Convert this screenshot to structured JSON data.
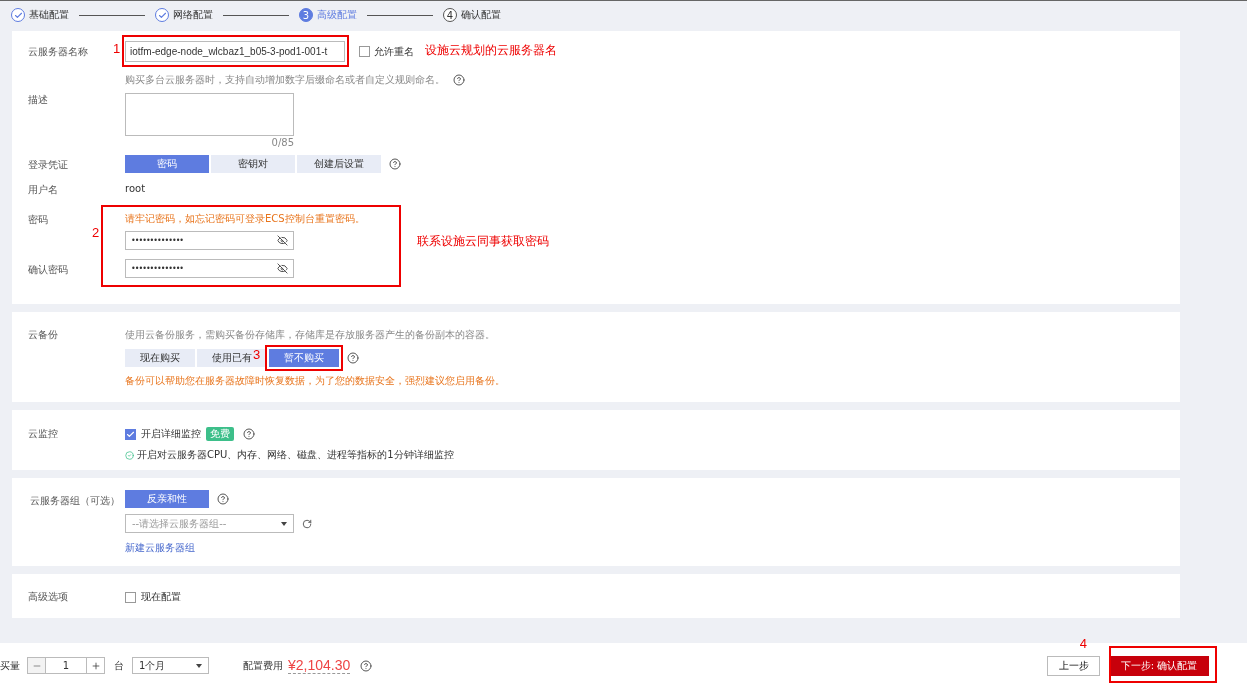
{
  "steps": [
    {
      "label": "基础配置",
      "done": true,
      "selected": false
    },
    {
      "label": "网络配置",
      "done": true,
      "selected": false
    },
    {
      "number": "3",
      "label": "高级配置",
      "done": false,
      "selected": true
    },
    {
      "number": "4",
      "label": "确认配置",
      "done": false,
      "selected": false
    }
  ],
  "server_name": {
    "label": "云服务器名称",
    "value": "iotfm-edge-node_wlcbaz1_b05-3-pod1-001-t",
    "allow_duplicate": {
      "label": "允许重名",
      "checked": false
    },
    "hint": "购买多台云服务器时，支持自动增加数字后缀命名或者自定义规则命名。"
  },
  "description": {
    "label": "描述",
    "counter": "0/85"
  },
  "login": {
    "label": "登录凭证",
    "options": [
      {
        "label": "密码",
        "selected": true
      },
      {
        "label": "密钥对",
        "selected": false
      },
      {
        "label": "创建后设置",
        "selected": false
      }
    ]
  },
  "username": {
    "label": "用户名",
    "value": "root"
  },
  "password": {
    "label": "密码",
    "warning": "请牢记密码，如忘记密码可登录ECS控制台重置密码。",
    "value": "••••••••••••••"
  },
  "confirm_password": {
    "label": "确认密码",
    "value": "••••••••••••••"
  },
  "backup": {
    "label": "云备份",
    "description": "使用云备份服务，需购买备份存储库，存储库是存放服务器产生的备份副本的容器。",
    "options": [
      {
        "label": "现在购买",
        "selected": false
      },
      {
        "label": "使用已有",
        "selected": false
      },
      {
        "label": "暂不购买",
        "selected": true
      }
    ],
    "warning": "备份可以帮助您在服务器故障时恢复数据，为了您的数据安全，强烈建议您启用备份。"
  },
  "monitoring": {
    "label": "云监控",
    "option": {
      "label": "开启详细监控",
      "checked": true
    },
    "badge": "免费",
    "note": "开启对云服务器CPU、内存、网络、磁盘、进程等指标的1分钟详细监控"
  },
  "server_group": {
    "label": "云服务器组（可选）",
    "policy_button": "反亲和性",
    "select_placeholder": "--请选择云服务器组--",
    "create_link": "新建云服务器组"
  },
  "advanced": {
    "label": "高级选项",
    "option": {
      "label": "现在配置",
      "checked": false
    }
  },
  "footer": {
    "quantity_label": "买量",
    "quantity": "1",
    "unit": "台",
    "duration": "1个月",
    "fee_label": "配置费用",
    "fee": "¥2,104.30",
    "prev": "上一步",
    "next": "下一步: 确认配置"
  },
  "annotations": [
    {
      "number": "1",
      "note": "设施云规划的云服务器名"
    },
    {
      "number": "2",
      "note": "联系设施云同事获取密码"
    },
    {
      "number": "3"
    },
    {
      "number": "4"
    }
  ]
}
